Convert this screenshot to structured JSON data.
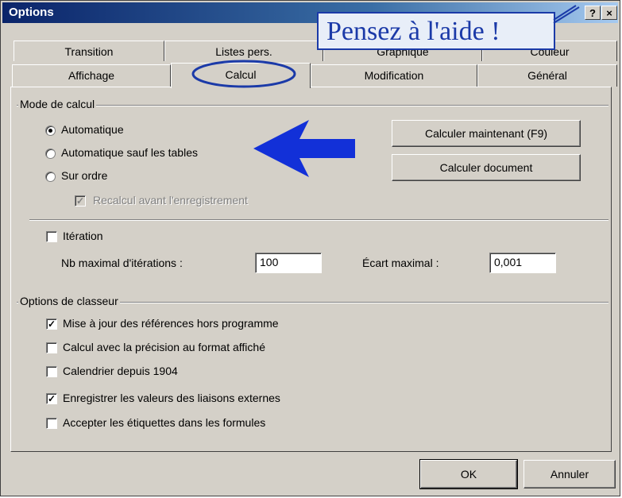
{
  "window": {
    "title": "Options",
    "help_btn": "?",
    "close_btn": "×"
  },
  "callout": {
    "text": "Pensez à l'aide !"
  },
  "tabs": {
    "back_row": [
      "Transition",
      "Listes pers.",
      "Graphique",
      "Couleur"
    ],
    "front_row": [
      "Affichage",
      "Calcul",
      "Modification",
      "Général"
    ],
    "active": "Calcul"
  },
  "mode_calcul": {
    "label": "Mode de calcul",
    "options": [
      {
        "label": "Automatique",
        "selected": true
      },
      {
        "label": "Automatique sauf les tables",
        "selected": false
      },
      {
        "label": "Sur ordre",
        "selected": false
      }
    ],
    "recalcul": {
      "label": "Recalcul avant l'enregistrement",
      "checked": true,
      "disabled": true
    },
    "btn_calc_now": "Calculer maintenant (F9)",
    "btn_calc_doc": "Calculer document"
  },
  "iteration": {
    "label": "Itération",
    "checked": false,
    "max_iter_label": "Nb maximal d'itérations :",
    "max_iter_value": "100",
    "max_gap_label": "Écart maximal :",
    "max_gap_value": "0,001"
  },
  "classeur": {
    "label": "Options de classeur",
    "items": [
      {
        "label": "Mise à jour des références hors programme",
        "checked": true
      },
      {
        "label": "Calcul avec la précision au format affiché",
        "checked": false
      },
      {
        "label": "Calendrier depuis 1904",
        "checked": false
      },
      {
        "label": "Enregistrer les valeurs des liaisons externes",
        "checked": true
      },
      {
        "label": "Accepter les étiquettes dans les formules",
        "checked": false
      }
    ]
  },
  "footer": {
    "ok": "OK",
    "cancel": "Annuler"
  },
  "colors": {
    "annotation": "#1b3aa8",
    "arrow": "#1230d8"
  }
}
